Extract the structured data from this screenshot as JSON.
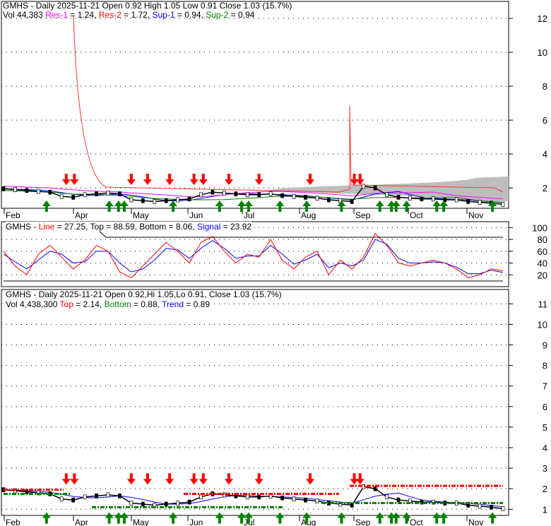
{
  "chart_data": [
    {
      "type": "line",
      "title": "GMHS - Daily 2025-11-21 Open 0.92  High 1.05  Low 0.91  Close 1.03 (15.7%)",
      "legend": {
        "vol": "Vol 44,383",
        "res1_label": "Res-1",
        "res1_value": " = 1.24, ",
        "res2_label": "Res-2",
        "res2_value": " = 1.72, ",
        "sup1_label": "Sup-1",
        "sup1_value": " = 0.94, ",
        "sup2_label": "Sup-2",
        "sup2_value": " = 0.94"
      },
      "yticks": [
        "12",
        "10",
        "8",
        "6",
        "4",
        "2"
      ],
      "ylim": [
        0.8,
        13
      ],
      "months": [
        "Feb",
        "Apr",
        "May",
        "Jun",
        "Jul",
        "Aug",
        "Sep",
        "Oct",
        "Nov"
      ],
      "weekly_close": [
        1.95,
        1.9,
        1.85,
        1.8,
        1.75,
        1.5,
        1.45,
        1.6,
        1.65,
        1.7,
        1.65,
        1.3,
        1.25,
        1.2,
        1.25,
        1.3,
        1.35,
        1.6,
        1.75,
        1.7,
        1.65,
        1.6,
        1.6,
        1.65,
        1.55,
        1.5,
        1.45,
        1.4,
        1.3,
        1.25,
        1.2,
        2.1,
        2.0,
        1.6,
        1.45,
        1.4,
        1.35,
        1.35,
        1.3,
        1.3,
        1.2,
        1.15,
        1.1,
        1.03
      ],
      "down_arrows": [
        5.4,
        6.1,
        11,
        12.4,
        14.3,
        16.4,
        17.2,
        19.4,
        22,
        26.4,
        30.2,
        30.7
      ],
      "up_arrows": [
        3.7,
        9.1,
        9.9,
        10.4,
        14.6,
        18.6,
        20.5,
        21.1,
        23.8,
        26.1,
        29.1,
        32.4,
        33.4,
        33.8,
        34.7,
        37.3,
        37.9,
        42.1
      ],
      "colors": {
        "res1": "#ff00ff",
        "res2": "#ff0000",
        "sup1": "#0000ff",
        "sup2": "#008000"
      }
    },
    {
      "type": "line",
      "legend": {
        "name": "GMHS - ",
        "line_label": "Line",
        "line_value": " = 27.25, Top = 88.59, Bottom = 8.06, ",
        "signal_label": "Signal",
        "signal_value": " = 23.92"
      },
      "yticks": [
        "100",
        "80",
        "60",
        "40",
        "20"
      ],
      "ylim": [
        0,
        110
      ],
      "line": [
        60,
        35,
        20,
        55,
        70,
        50,
        30,
        45,
        70,
        60,
        25,
        15,
        35,
        55,
        75,
        60,
        40,
        75,
        85,
        60,
        40,
        55,
        50,
        80,
        45,
        30,
        50,
        60,
        20,
        45,
        30,
        50,
        90,
        70,
        40,
        35,
        40,
        45,
        40,
        30,
        15,
        20,
        30,
        27
      ],
      "signal": [
        55,
        42,
        30,
        45,
        60,
        55,
        40,
        42,
        60,
        60,
        40,
        25,
        30,
        45,
        65,
        62,
        48,
        65,
        78,
        65,
        48,
        52,
        52,
        70,
        55,
        38,
        45,
        55,
        32,
        40,
        35,
        45,
        80,
        72,
        48,
        40,
        40,
        42,
        40,
        33,
        22,
        22,
        28,
        24
      ]
    },
    {
      "type": "line",
      "title": "GMHS - Daily 2025-11-21 Open 0.92,Hi 1.05,Lo 0.91, Close 1.03 (15.7%)",
      "legend": {
        "vol": "Vol 4,438,300 ",
        "top_label": "Top",
        "top_value": " = 2.14, ",
        "bottom_label": "Bottom",
        "bottom_value": " = 0.88, ",
        "trend_label": "Trend",
        "trend_value": " = 0.89"
      },
      "yticks": [
        "11",
        "10",
        "9",
        "8",
        "7",
        "6",
        "5",
        "4",
        "3",
        "2",
        "1"
      ],
      "ylim": [
        0.7,
        11.7
      ],
      "months": [
        "Feb",
        "Apr",
        "May",
        "Jun",
        "Jul",
        "Aug",
        "Sep",
        "Oct",
        "Nov"
      ]
    }
  ]
}
